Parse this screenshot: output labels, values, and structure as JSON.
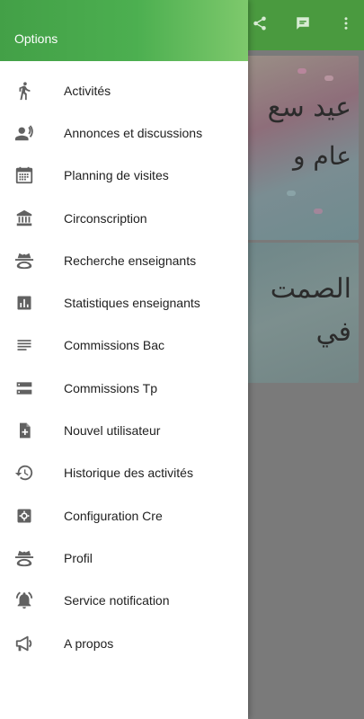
{
  "app_bar": {
    "actions": [
      {
        "icon": "share-icon"
      },
      {
        "icon": "chat-icon"
      },
      {
        "icon": "more-vert-icon"
      }
    ]
  },
  "content": {
    "cards": [
      {
        "lines": [
          "عيد سع",
          "عام و"
        ]
      },
      {
        "lines": [
          "الصمت",
          "في"
        ]
      }
    ]
  },
  "drawer": {
    "title": "Options",
    "items": [
      {
        "label": "Activités",
        "icon": "walk-icon"
      },
      {
        "label": "Annonces et discussions",
        "icon": "speaker-person-icon"
      },
      {
        "label": "Planning de visites",
        "icon": "calendar-icon"
      },
      {
        "label": "Circonscription",
        "icon": "bank-icon"
      },
      {
        "label": "Recherche enseignants",
        "icon": "incognito-icon"
      },
      {
        "label": "Statistiques enseignants",
        "icon": "bar-chart-icon"
      },
      {
        "label": "Commissions Bac",
        "icon": "lines-icon"
      },
      {
        "label": "Commissions Tp",
        "icon": "storage-icon"
      },
      {
        "label": "Nouvel utilisateur",
        "icon": "add-file-icon"
      },
      {
        "label": "Historique des activités",
        "icon": "history-icon"
      },
      {
        "label": "Configuration Cre",
        "icon": "settings-box-icon"
      },
      {
        "label": "Profil",
        "icon": "incognito-icon"
      },
      {
        "label": "Service notification",
        "icon": "bell-ring-icon"
      },
      {
        "label": "A propos",
        "icon": "megaphone-icon"
      }
    ]
  },
  "colors": {
    "header_green": "#43a047",
    "appbar_green": "#4a9a3f",
    "scrim": "#7a7a7a"
  }
}
